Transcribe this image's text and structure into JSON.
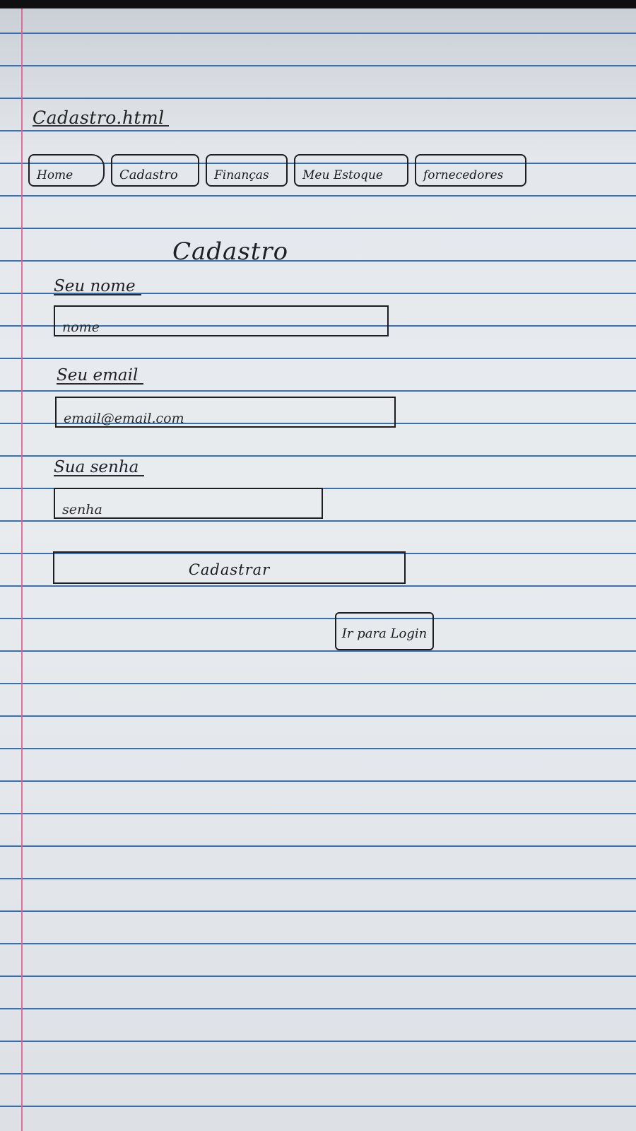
{
  "page": {
    "file_title": "Cadastro.html"
  },
  "nav": {
    "items": [
      {
        "label": "Home"
      },
      {
        "label": "Cadastro"
      },
      {
        "label": "Finanças"
      },
      {
        "label": "Meu Estoque"
      },
      {
        "label": "fornecedores"
      }
    ]
  },
  "form": {
    "heading": "Cadastro",
    "fields": {
      "name": {
        "label": "Seu nome",
        "placeholder": "nome"
      },
      "email": {
        "label": "Seu email",
        "placeholder": "email@email.com"
      },
      "password": {
        "label": "Sua senha",
        "placeholder": "senha"
      }
    },
    "submit_label": "Cadastrar",
    "login_link_label": "Ir para Login"
  },
  "colors": {
    "ink": "#1c1c22",
    "rule_line": "#3d78b4",
    "margin_line": "#e05a8f"
  }
}
